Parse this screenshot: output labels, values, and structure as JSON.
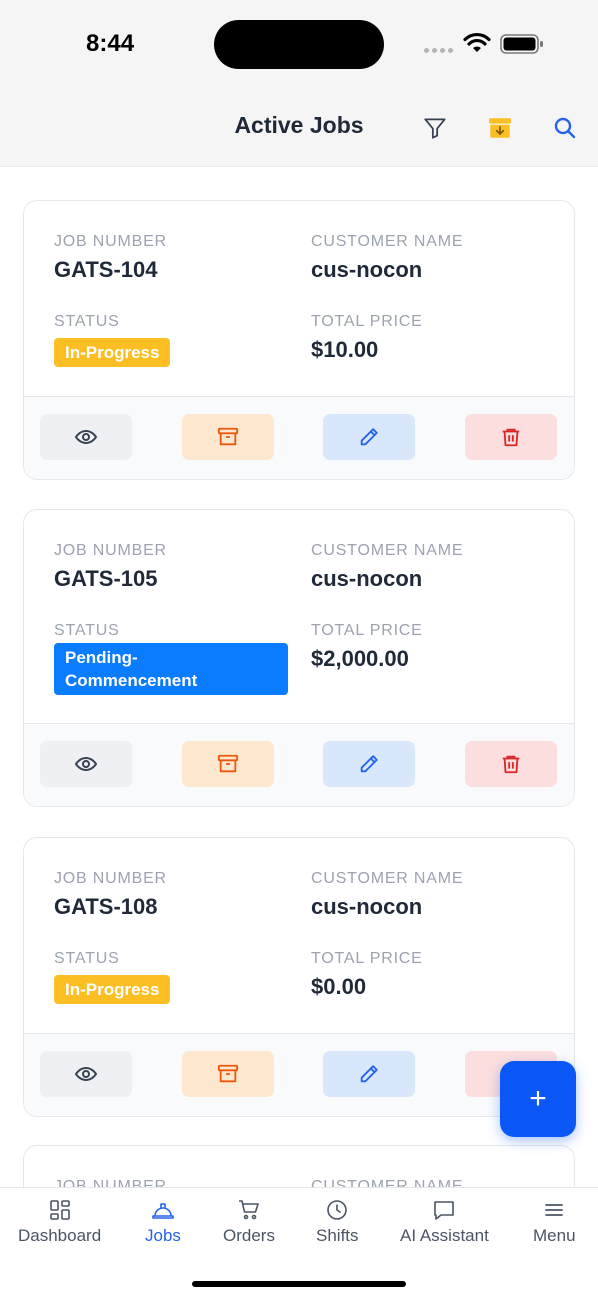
{
  "status_bar": {
    "time": "8:44"
  },
  "header": {
    "title": "Active Jobs",
    "icons": [
      "filter-icon",
      "archive-icon",
      "search-icon"
    ]
  },
  "labels": {
    "job_number": "JOB NUMBER",
    "customer_name": "CUSTOMER NAME",
    "status": "STATUS",
    "total_price": "TOTAL PRICE"
  },
  "jobs": [
    {
      "job_number": "GATS-104",
      "customer_name": "cus-nocon",
      "status": "In-Progress",
      "total_price": "$10.00"
    },
    {
      "job_number": "GATS-105",
      "customer_name": "cus-nocon",
      "status": "Pending-Commencement",
      "status_line1": "Pending-",
      "status_line2": "Commencement",
      "total_price": "$2,000.00"
    },
    {
      "job_number": "GATS-108",
      "customer_name": "cus-nocon",
      "status": "In-Progress",
      "total_price": "$0.00"
    },
    {
      "job_number": "",
      "customer_name": ""
    }
  ],
  "card_actions": [
    "eye-icon",
    "archive-icon",
    "pencil-icon",
    "trash-icon"
  ],
  "fab": {
    "label": "+"
  },
  "tabs": [
    {
      "label": "Dashboard",
      "icon": "grid-icon"
    },
    {
      "label": "Jobs",
      "icon": "hard-hat-icon",
      "active": true
    },
    {
      "label": "Orders",
      "icon": "cart-icon"
    },
    {
      "label": "Shifts",
      "icon": "clock-icon"
    },
    {
      "label": "AI Assistant",
      "icon": "chat-icon"
    },
    {
      "label": "Menu",
      "icon": "menu-icon"
    }
  ],
  "colors": {
    "in_progress": "#fbbf24",
    "pending": "#0a7cff",
    "accent": "#2563eb",
    "fab": "#0b57f5"
  }
}
